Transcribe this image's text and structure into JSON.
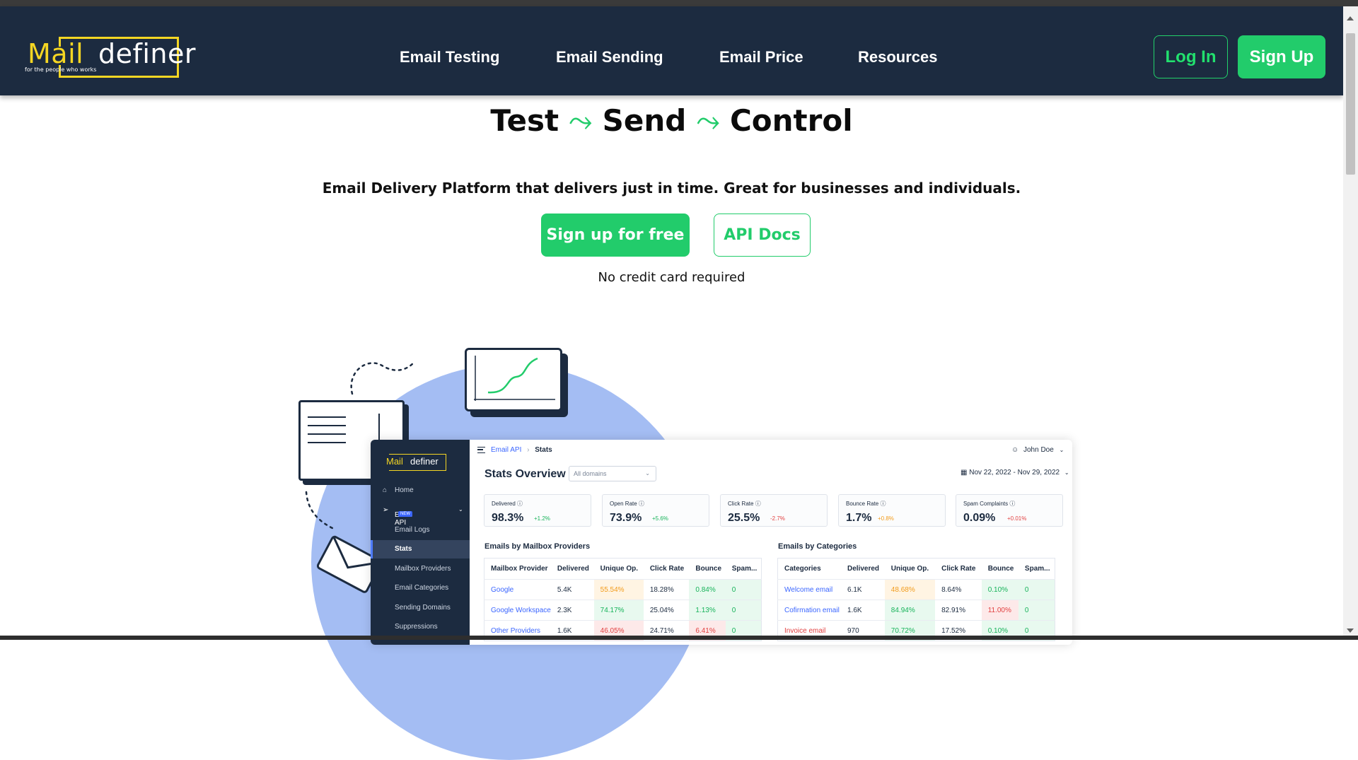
{
  "header": {
    "logo": {
      "word1": "Mail",
      "word2": "definer",
      "tagline": "for the people who works"
    },
    "nav": [
      "Email Testing",
      "Email Sending",
      "Email Price",
      "Resources"
    ],
    "login_label": "Log In",
    "signup_label": "Sign Up"
  },
  "hero": {
    "title_words": [
      "Test",
      "Send",
      "Control"
    ],
    "title_arrow": "⤳",
    "subtitle": "Email Delivery Platform that delivers just in time. Great for businesses and individuals.",
    "cta_primary": "Sign up for free",
    "cta_secondary": "API Docs",
    "note": "No credit card required"
  },
  "dashboard": {
    "sidebar": {
      "logo_word1": "Mail",
      "logo_word2": "definer",
      "items": [
        {
          "label": "Home",
          "icon": "home-icon"
        },
        {
          "label": "Email API",
          "icon": "send-icon",
          "badge": "NEW"
        },
        {
          "label": "Email Logs"
        },
        {
          "label": "Stats"
        },
        {
          "label": "Mailbox Providers"
        },
        {
          "label": "Email Categories"
        },
        {
          "label": "Sending Domains"
        },
        {
          "label": "Suppressions"
        }
      ]
    },
    "breadcrumb": {
      "parent": "Email API",
      "current": "Stats"
    },
    "user": "John Doe",
    "title": "Stats Overview",
    "domain_select": "All domains",
    "date_range": "Nov 22, 2022 - Nov 29, 2022",
    "stats": [
      {
        "label": "Delivered",
        "value": "98.3%",
        "delta": "+1.2%",
        "tone": "green"
      },
      {
        "label": "Open Rate",
        "value": "73.9%",
        "delta": "+5.6%",
        "tone": "green"
      },
      {
        "label": "Click Rate",
        "value": "25.5%",
        "delta": "-2.7%",
        "tone": "red"
      },
      {
        "label": "Bounce Rate",
        "value": "1.7%",
        "delta": "+0.8%",
        "tone": "orange"
      },
      {
        "label": "Spam Complaints",
        "value": "0.09%",
        "delta": "+0.01%",
        "tone": "red"
      }
    ],
    "providers": {
      "title": "Emails by Mailbox Providers",
      "headers": [
        "Mailbox Provider",
        "Delivered",
        "Unique Op.",
        "Click Rate",
        "Bounce",
        "Spam..."
      ],
      "rows": [
        [
          "Google",
          "5.4K",
          "55.54%",
          "18.28%",
          "0.84%",
          "0"
        ],
        [
          "Google Workspace",
          "2.3K",
          "74.17%",
          "25.04%",
          "1.13%",
          "0"
        ],
        [
          "Other Providers",
          "1.6K",
          "46.05%",
          "24.71%",
          "6.41%",
          "0"
        ]
      ]
    },
    "categories": {
      "title": "Emails by Categories",
      "headers": [
        "Categories",
        "Delivered",
        "Unique Op.",
        "Click Rate",
        "Bounce",
        "Spam..."
      ],
      "rows": [
        [
          "Welcome email",
          "6.1K",
          "48.68%",
          "8.64%",
          "0.10%",
          "0"
        ],
        [
          "Cofirmation email",
          "1.6K",
          "84.94%",
          "82.91%",
          "11.00%",
          "0"
        ],
        [
          "Invoice email",
          "970",
          "70.72%",
          "17.52%",
          "0.10%",
          "0"
        ]
      ]
    }
  }
}
